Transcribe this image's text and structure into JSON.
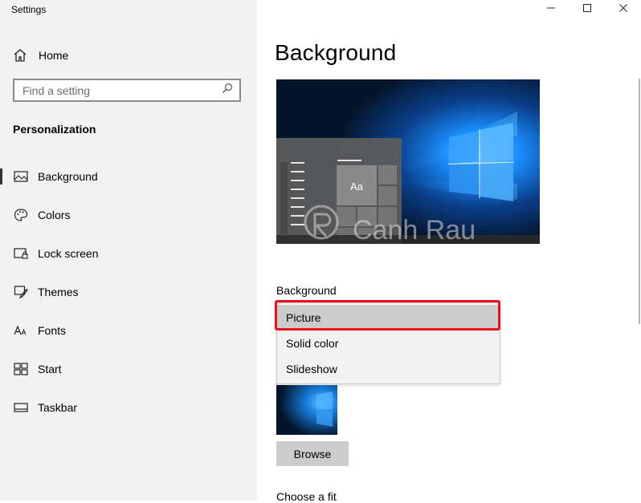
{
  "window": {
    "title": "Settings",
    "controls": [
      "minimize",
      "maximize",
      "close"
    ]
  },
  "sidebar": {
    "home_label": "Home",
    "search": {
      "placeholder": "Find a setting",
      "value": ""
    },
    "section_title": "Personalization",
    "items": [
      {
        "label": "Background",
        "icon": "image-icon",
        "active": true
      },
      {
        "label": "Colors",
        "icon": "palette-icon",
        "active": false
      },
      {
        "label": "Lock screen",
        "icon": "lock-screen-icon",
        "active": false
      },
      {
        "label": "Themes",
        "icon": "brush-icon",
        "active": false
      },
      {
        "label": "Fonts",
        "icon": "font-icon",
        "active": false
      },
      {
        "label": "Start",
        "icon": "start-icon",
        "active": false
      },
      {
        "label": "Taskbar",
        "icon": "taskbar-icon",
        "active": false
      }
    ]
  },
  "main": {
    "title": "Background",
    "preview": {
      "tile_label": "Aa",
      "watermark": "Canh Rau"
    },
    "background_label": "Background",
    "dropdown": {
      "options": [
        "Picture",
        "Solid color",
        "Slideshow"
      ],
      "selected": "Picture",
      "highlight_color": "#e8121e"
    },
    "browse_label": "Browse",
    "choose_fit_label": "Choose a fit"
  },
  "colors": {
    "sidebar_bg": "#f2f2f2",
    "dropdown_selected_bg": "#cccccc",
    "wallpaper_blue": "#1a8fff",
    "wallpaper_dark": "#04152b"
  }
}
